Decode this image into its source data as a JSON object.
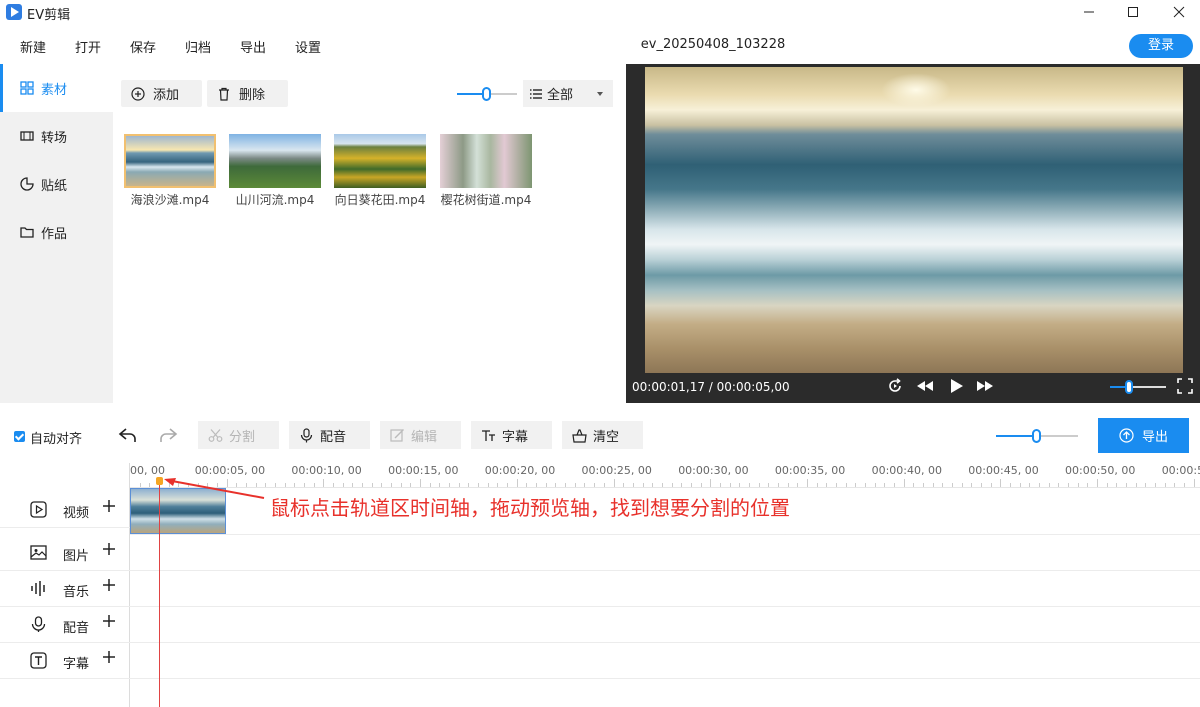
{
  "window": {
    "app_title": "EV剪辑"
  },
  "menu": {
    "items": [
      "新建",
      "打开",
      "保存",
      "归档",
      "导出",
      "设置"
    ],
    "doc_title": "ev_20250408_103228",
    "login": "登录"
  },
  "sidebar": {
    "items": [
      {
        "label": "素材",
        "icon": "grid-icon",
        "active": true
      },
      {
        "label": "转场",
        "icon": "film-icon",
        "active": false
      },
      {
        "label": "贴纸",
        "icon": "sticker-icon",
        "active": false
      },
      {
        "label": "作品",
        "icon": "folder-icon",
        "active": false
      }
    ]
  },
  "media": {
    "add_label": "添加",
    "delete_label": "删除",
    "zoom_value": "0",
    "filter_value": "全部",
    "clips": [
      {
        "name": "海浪沙滩.mp4",
        "selected": true
      },
      {
        "name": "山川河流.mp4",
        "selected": false
      },
      {
        "name": "向日葵花田.mp4",
        "selected": false
      },
      {
        "name": "樱花树街道.mp4",
        "selected": false
      }
    ]
  },
  "preview": {
    "time": "00:00:01,17 / 00:00:05,00",
    "volume_fraction": 0.35
  },
  "toolbar": {
    "auto_align": "自动对齐",
    "auto_align_checked": true,
    "split": "分割",
    "dub": "配音",
    "edit": "编辑",
    "subtitle": "字幕",
    "clear": "清空",
    "zoom_value": "0",
    "export": "导出"
  },
  "timeline": {
    "ruler_labels": [
      "00, 00",
      "00:00:05, 00",
      "00:00:10, 00",
      "00:00:15, 00",
      "00:00:20, 00",
      "00:00:25, 00",
      "00:00:30, 00",
      "00:00:35, 00",
      "00:00:40, 00",
      "00:00:45, 00",
      "00:00:50, 00",
      "00:00:5"
    ],
    "tracks": [
      {
        "label": "视频",
        "icon": "video-track-icon"
      },
      {
        "label": "图片",
        "icon": "image-track-icon"
      },
      {
        "label": "音乐",
        "icon": "music-track-icon"
      },
      {
        "label": "配音",
        "icon": "mic-track-icon"
      },
      {
        "label": "字幕",
        "icon": "text-track-icon"
      }
    ],
    "annotation": "鼠标点击轨道区时间轴，拖动预览轴，找到想要分割的位置"
  },
  "colors": {
    "accent": "#1a8cf0",
    "annotation": "#e8312b",
    "playhead": "#e04343"
  }
}
